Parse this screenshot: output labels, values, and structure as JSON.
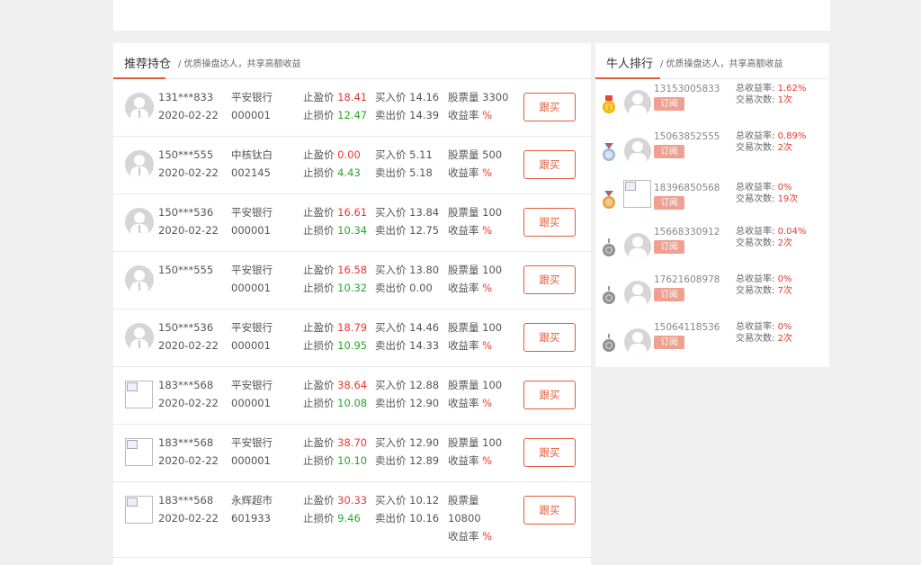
{
  "left_panel": {
    "title": "推荐持仓",
    "subtitle": "/ 优质操盘达人，共享高额收益",
    "labels": {
      "take_profit": "止盈价",
      "stop_loss": "止损价",
      "buy": "买入价",
      "sell": "卖出价",
      "volume": "股票量",
      "yield": "收益率",
      "yield_suffix": "%",
      "follow": "跟买"
    },
    "rows": [
      {
        "user": "131***833",
        "date": "2020-02-22",
        "stock": "平安银行",
        "code": "000001",
        "take_profit": "18.41",
        "stop_loss": "12.47",
        "buy": "14.16",
        "sell": "14.39",
        "volume": "3300",
        "avatar": "default"
      },
      {
        "user": "150***555",
        "date": "2020-02-22",
        "stock": "中核钛白",
        "code": "002145",
        "take_profit": "0.00",
        "stop_loss": "4.43",
        "buy": "5.11",
        "sell": "5.18",
        "volume": "500",
        "avatar": "default"
      },
      {
        "user": "150***536",
        "date": "2020-02-22",
        "stock": "平安银行",
        "code": "000001",
        "take_profit": "16.61",
        "stop_loss": "10.34",
        "buy": "13.84",
        "sell": "12.75",
        "volume": "100",
        "avatar": "default"
      },
      {
        "user": "150***555",
        "date": "",
        "stock": "平安银行",
        "code": "000001",
        "take_profit": "16.58",
        "stop_loss": "10.32",
        "buy": "13.80",
        "sell": "0.00",
        "volume": "100",
        "avatar": "default"
      },
      {
        "user": "150***536",
        "date": "2020-02-22",
        "stock": "平安银行",
        "code": "000001",
        "take_profit": "18.79",
        "stop_loss": "10.95",
        "buy": "14.46",
        "sell": "14.33",
        "volume": "100",
        "avatar": "default"
      },
      {
        "user": "183***568",
        "date": "2020-02-22",
        "stock": "平安银行",
        "code": "000001",
        "take_profit": "38.64",
        "stop_loss": "10.08",
        "buy": "12.88",
        "sell": "12.90",
        "volume": "100",
        "avatar": "broken"
      },
      {
        "user": "183***568",
        "date": "2020-02-22",
        "stock": "平安银行",
        "code": "000001",
        "take_profit": "38.70",
        "stop_loss": "10.10",
        "buy": "12.90",
        "sell": "12.89",
        "volume": "100",
        "avatar": "broken"
      },
      {
        "user": "183***568",
        "date": "2020-02-22",
        "stock": "永辉超市",
        "code": "601933",
        "take_profit": "30.33",
        "stop_loss": "9.46",
        "buy": "10.12",
        "sell": "10.16",
        "volume": "10800",
        "avatar": "broken",
        "wrap_volume": true
      }
    ]
  },
  "right_panel": {
    "title": "牛人排行",
    "subtitle": "/ 优质操盘达人，共享高额收益",
    "labels": {
      "total_yield": "总收益率:",
      "trades": "交易次数:",
      "subscribe": "订阅"
    },
    "items": [
      {
        "phone": "13153005833",
        "yield": "1.62%",
        "trades": "1次",
        "medal": "gold",
        "avatar": "default"
      },
      {
        "phone": "15063852555",
        "yield": "0.89%",
        "trades": "2次",
        "medal": "silver",
        "avatar": "default"
      },
      {
        "phone": "18396850568",
        "yield": "0%",
        "trades": "19次",
        "medal": "bronze",
        "avatar": "broken"
      },
      {
        "phone": "15668330912",
        "yield": "0.04%",
        "trades": "2次",
        "medal": "gear",
        "avatar": "default"
      },
      {
        "phone": "17621608978",
        "yield": "0%",
        "trades": "7次",
        "medal": "gear",
        "avatar": "default"
      },
      {
        "phone": "15064118536",
        "yield": "0%",
        "trades": "2次",
        "medal": "gear",
        "avatar": "default"
      }
    ]
  },
  "colors": {
    "accent": "#e35b3a",
    "red": "#e8382f",
    "green": "#2aa62a"
  }
}
